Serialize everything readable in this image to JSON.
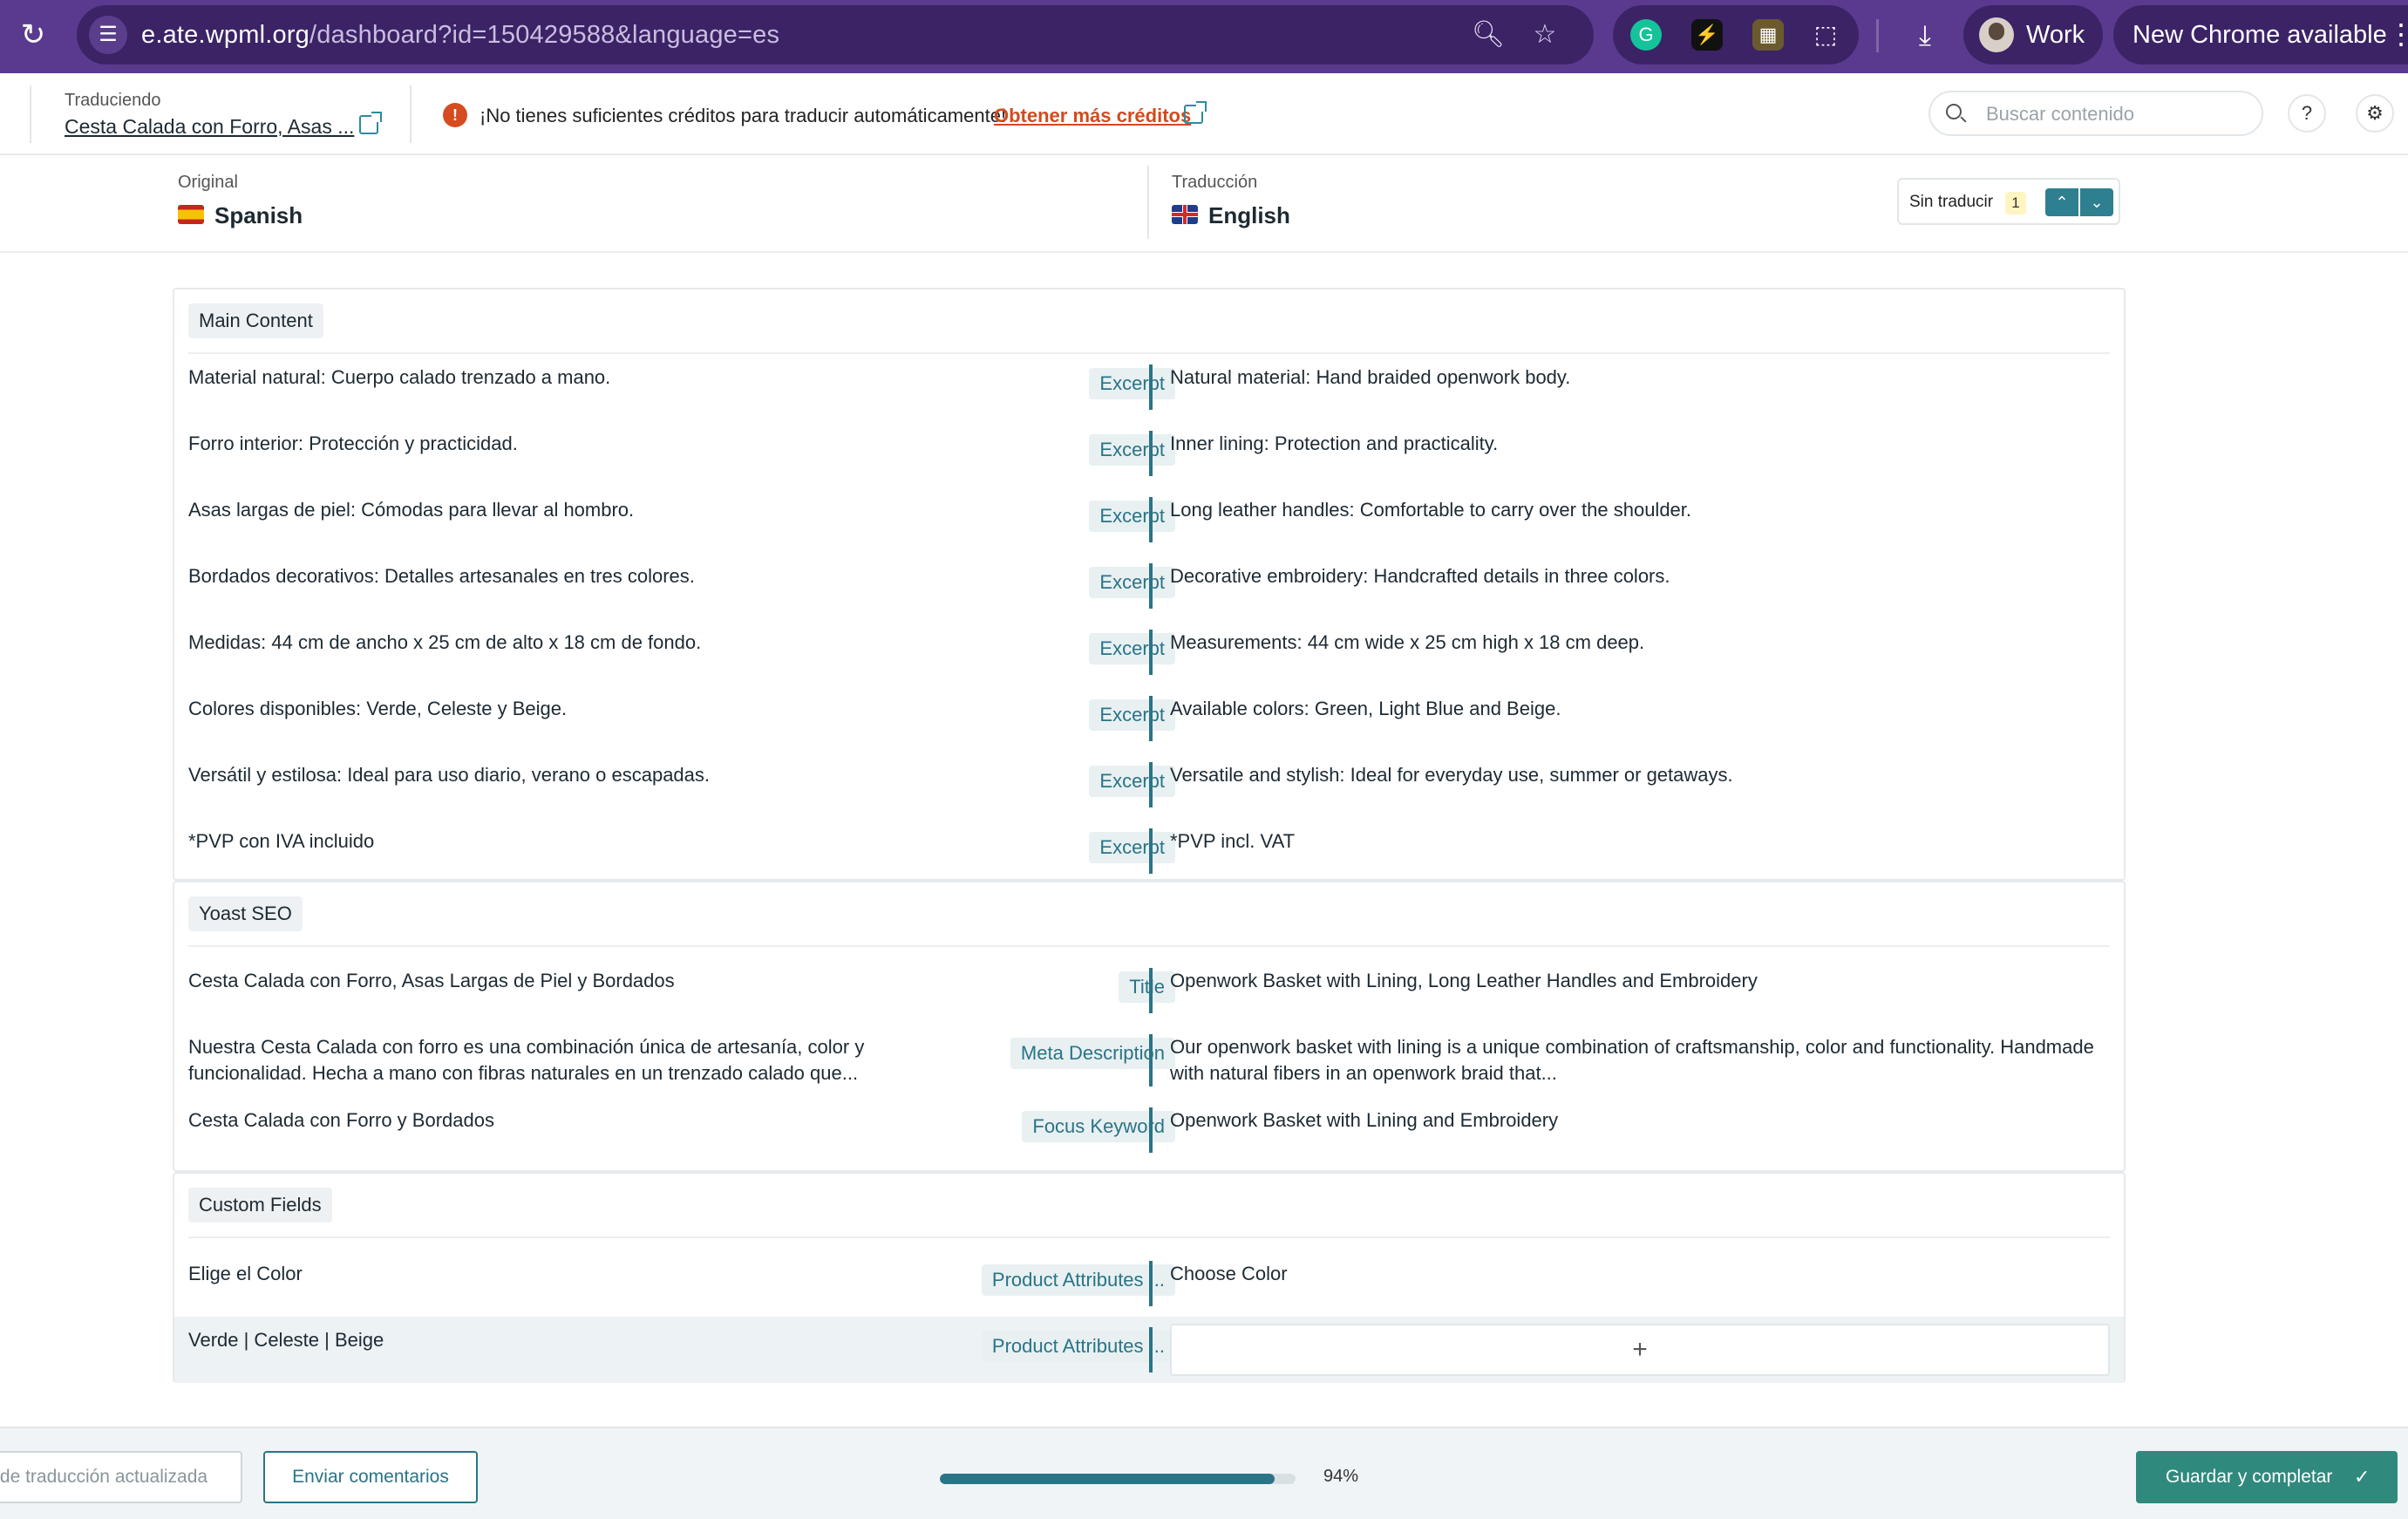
{
  "browser": {
    "url_host": "e.ate.wpml.org",
    "url_path": "/dashboard?id=150429588&language=es",
    "profile_label": "Work",
    "update_label": "New Chrome available",
    "extensions": [
      "grammarly-icon",
      "bolt-extension-icon",
      "rainbow-extension-icon",
      "puzzle-icon"
    ]
  },
  "header": {
    "translating_caption": "Traduciendo",
    "translating_title": "Cesta Calada con Forro, Asas ...",
    "warning_text": "¡No tienes suficientes créditos para traducir automáticamente!",
    "credits_link": "Obtener más créditos",
    "search_placeholder": "Buscar contenido"
  },
  "languages": {
    "original_caption": "Original",
    "original_name": "Spanish",
    "translation_caption": "Traducción",
    "translation_name": "English",
    "filter_label": "Sin traducir",
    "filter_count": "1"
  },
  "sections": [
    {
      "title": "Main Content",
      "rows": [
        {
          "src": "Material natural: Cuerpo calado trenzado a mano.",
          "tag": "Excerpt",
          "tgt": "Natural material: Hand braided openwork body."
        },
        {
          "src": "Forro interior: Protección y practicidad.",
          "tag": "Excerpt",
          "tgt": "Inner lining: Protection and practicality."
        },
        {
          "src": "Asas largas de piel: Cómodas para llevar al hombro.",
          "tag": "Excerpt",
          "tgt": "Long leather handles: Comfortable to carry over the shoulder."
        },
        {
          "src": "Bordados decorativos: Detalles artesanales en tres colores.",
          "tag": "Excerpt",
          "tgt": "Decorative embroidery: Handcrafted details in three colors."
        },
        {
          "src": "Medidas: 44 cm de ancho x 25 cm de alto x 18 cm de fondo.",
          "tag": "Excerpt",
          "tgt": "Measurements: 44 cm wide x 25 cm high x 18 cm deep."
        },
        {
          "src": "Colores disponibles: Verde, Celeste y Beige.",
          "tag": "Excerpt",
          "tgt": "Available colors: Green, Light Blue and Beige."
        },
        {
          "src": "Versátil y estilosa: Ideal para uso diario, verano o escapadas.",
          "tag": "Excerpt",
          "tgt": "Versatile and stylish: Ideal for everyday use, summer or getaways."
        },
        {
          "src": "*PVP con IVA incluido",
          "tag": "Excerpt",
          "tgt": "*PVP incl. VAT"
        }
      ]
    },
    {
      "title": "Yoast SEO",
      "rows": [
        {
          "src": "Cesta Calada con Forro, Asas Largas de Piel y Bordados",
          "tag": "Title",
          "tgt": "Openwork Basket with Lining, Long Leather Handles and Embroidery"
        },
        {
          "src": "Nuestra Cesta Calada con forro es una combinación única de artesanía, color y funcionalidad. Hecha a mano con fibras naturales en un trenzado calado que...",
          "tag": "Meta Description",
          "tgt": "Our openwork basket with lining is a unique combination of craftsmanship, color and functionality. Handmade with natural fibers in an openwork braid that..."
        },
        {
          "src": "Cesta Calada con Forro y Bordados",
          "tag": "Focus Keyword",
          "tgt": "Openwork Basket with Lining and Embroidery"
        }
      ]
    },
    {
      "title": "Custom Fields",
      "rows": [
        {
          "src": "Elige el Color",
          "tag": "Product Attributes ...",
          "tgt": "Choose Color"
        },
        {
          "src": "Verde | Celeste | Beige",
          "tag": "Product Attributes ...",
          "tgt": "+"
        }
      ]
    }
  ],
  "footer": {
    "memory_button": "de traducción actualizada",
    "feedback_button": "Enviar comentarios",
    "progress_value": 0.94,
    "progress_label": "94%",
    "save_button": "Guardar y completar"
  },
  "colors": {
    "browser_bar": "#5a3a8e",
    "accent": "#2a7487",
    "primary_button": "#2f8a7d",
    "warning": "#d64b1f"
  }
}
